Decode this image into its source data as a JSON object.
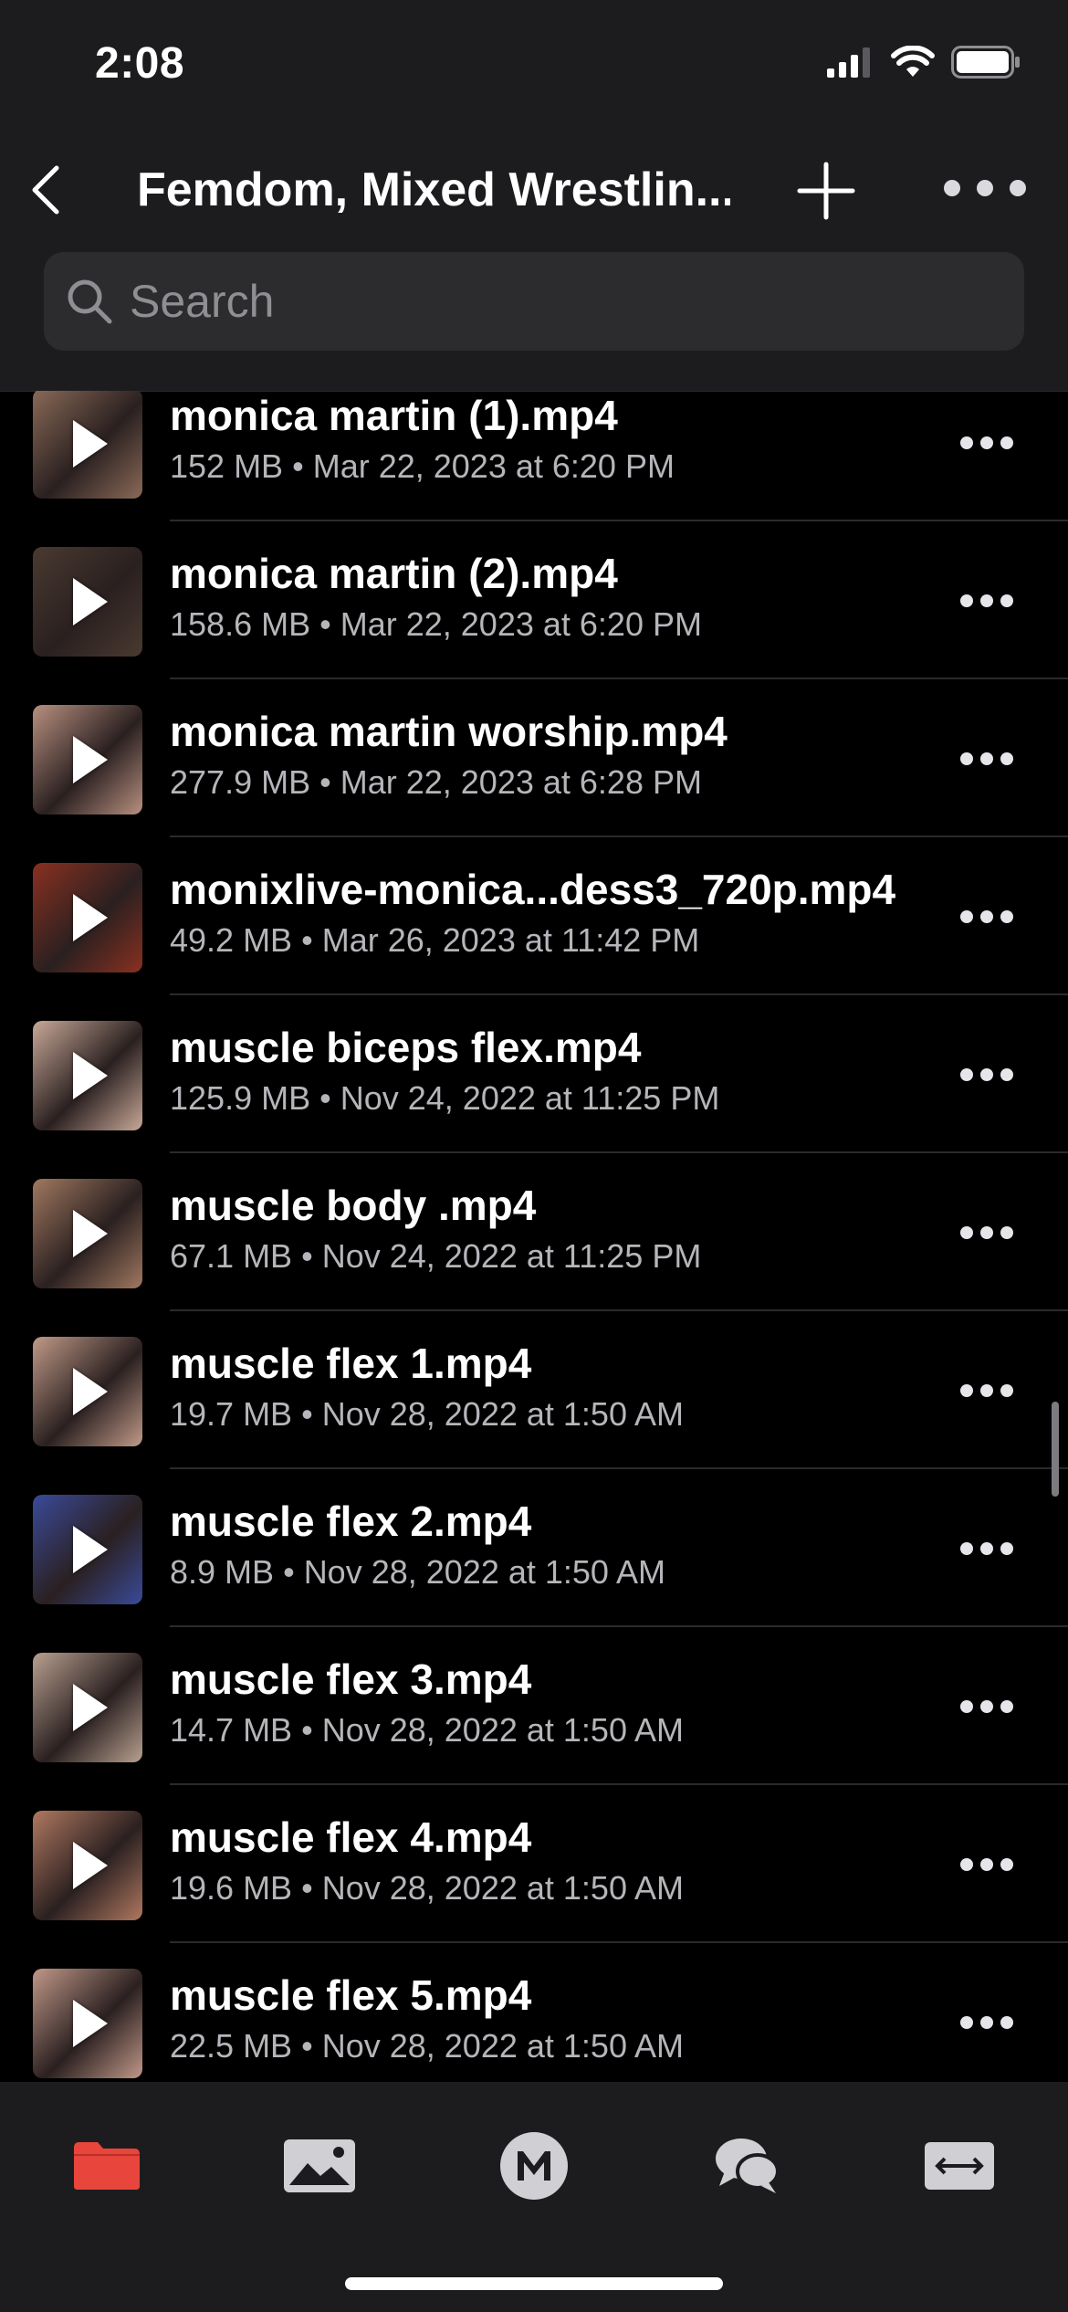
{
  "status_bar": {
    "time": "2:08"
  },
  "nav": {
    "title": "Femdom, Mixed Wrestlin..."
  },
  "search": {
    "placeholder": "Search"
  },
  "files": [
    {
      "name": "monica martin (1).mp4",
      "size": "152 MB",
      "date": "Mar 22, 2023 at 6:20 PM",
      "thumb_color": "#8a6a58"
    },
    {
      "name": "monica martin (2).mp4",
      "size": "158.6 MB",
      "date": "Mar 22, 2023 at 6:20 PM",
      "thumb_color": "#4a3a30"
    },
    {
      "name": "monica martin worship.mp4",
      "size": "277.9 MB",
      "date": "Mar 22, 2023 at 6:28 PM",
      "thumb_color": "#b89080"
    },
    {
      "name": "monixlive-monica...dess3_720p.mp4",
      "size": "49.2 MB",
      "date": "Mar 26, 2023 at 11:42 PM",
      "thumb_color": "#8a3020"
    },
    {
      "name": "muscle biceps flex.mp4",
      "size": "125.9 MB",
      "date": "Nov 24, 2022 at 11:25 PM",
      "thumb_color": "#c8a898"
    },
    {
      "name": "muscle body .mp4",
      "size": "67.1 MB",
      "date": "Nov 24, 2022 at 11:25 PM",
      "thumb_color": "#a07860"
    },
    {
      "name": "muscle flex 1.mp4",
      "size": "19.7 MB",
      "date": "Nov 28, 2022 at 1:50 AM",
      "thumb_color": "#c09a88"
    },
    {
      "name": "muscle flex 2.mp4",
      "size": "8.9 MB",
      "date": "Nov 28, 2022 at 1:50 AM",
      "thumb_color": "#3a4a9a"
    },
    {
      "name": "muscle flex 3.mp4",
      "size": "14.7 MB",
      "date": "Nov 28, 2022 at 1:50 AM",
      "thumb_color": "#b8a090"
    },
    {
      "name": "muscle flex 4.mp4",
      "size": "19.6 MB",
      "date": "Nov 28, 2022 at 1:50 AM",
      "thumb_color": "#b07860"
    },
    {
      "name": "muscle flex 5.mp4",
      "size": "22.5 MB",
      "date": "Nov 28, 2022 at 1:50 AM",
      "thumb_color": "#c09888"
    }
  ],
  "meta_separator": "•",
  "tabbar": {
    "items": [
      {
        "icon": "folder-icon",
        "active": true,
        "color": "#e8453c"
      },
      {
        "icon": "photo-icon",
        "active": false,
        "color": "#d0d0d4"
      },
      {
        "icon": "m-logo-icon",
        "active": false,
        "color": "#d0d0d4"
      },
      {
        "icon": "chat-bubbles-icon",
        "active": false,
        "color": "#d0d0d4"
      },
      {
        "icon": "transfer-arrows-icon",
        "active": false,
        "color": "#d0d0d4"
      }
    ]
  }
}
